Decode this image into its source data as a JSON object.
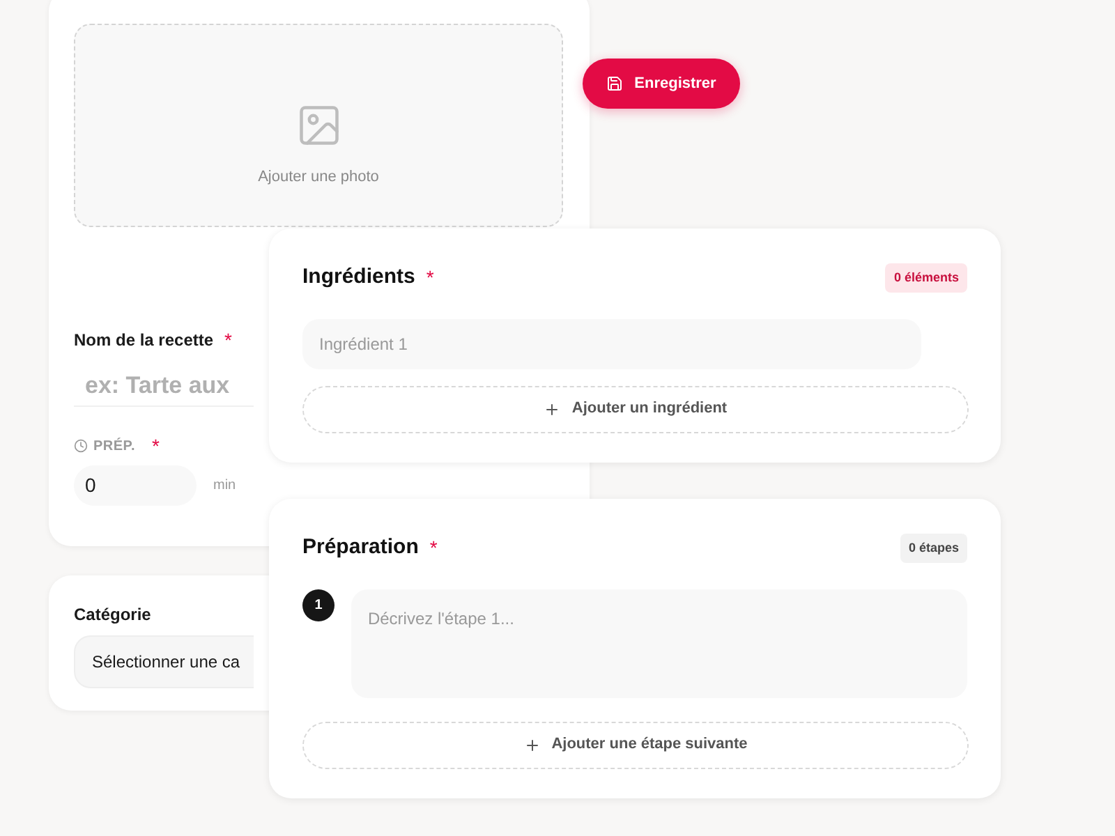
{
  "photo": {
    "label": "Ajouter une photo"
  },
  "recipe_name": {
    "label": "Nom de la recette",
    "required_mark": "*",
    "placeholder": "ex: Tarte aux"
  },
  "prep_time": {
    "label": "PRÉP.",
    "required_mark": "*",
    "value": "0",
    "unit": "min"
  },
  "category": {
    "label": "Catégorie",
    "value": "Sélectionner une ca"
  },
  "save_button": {
    "label": "Enregistrer"
  },
  "ingredients": {
    "title": "Ingrédients",
    "required_mark": "*",
    "count": "0 éléments",
    "items": [
      {
        "placeholder": "Ingrédient 1"
      }
    ],
    "add_label": "Ajouter un ingrédient"
  },
  "preparation": {
    "title": "Préparation",
    "required_mark": "*",
    "count": "0 étapes",
    "steps": [
      {
        "number": "1",
        "placeholder": "Décrivez l'étape 1..."
      }
    ],
    "add_label": "Ajouter une étape suivante"
  }
}
